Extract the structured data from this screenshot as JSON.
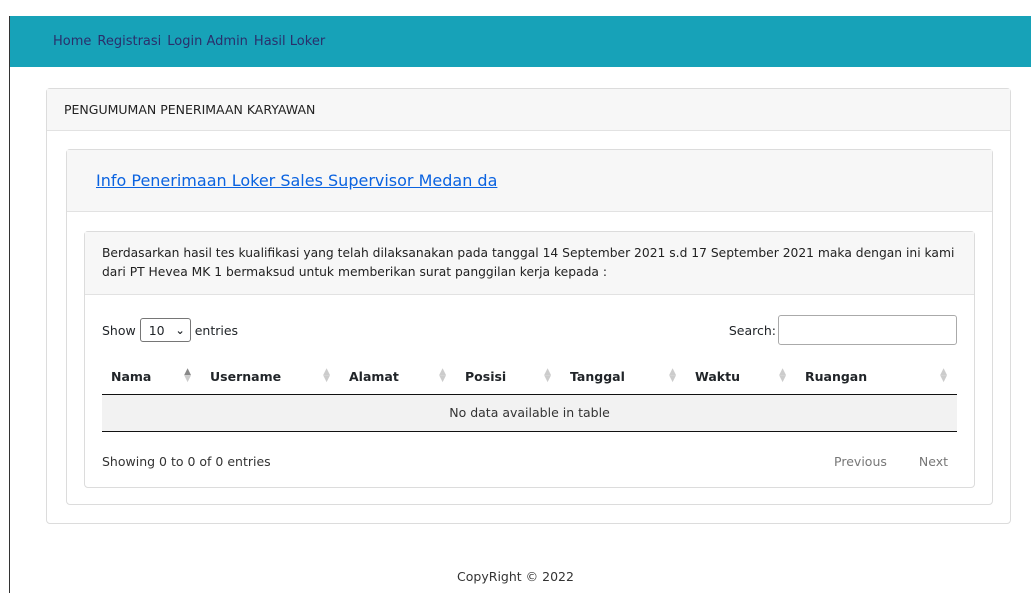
{
  "nav": {
    "items": [
      {
        "label": "Home"
      },
      {
        "label": "Registrasi"
      },
      {
        "label": "Login Admin"
      },
      {
        "label": "Hasil Loker"
      }
    ]
  },
  "panel": {
    "title": "PENGUMUMAN PENERIMAAN KARYAWAN"
  },
  "announcement": {
    "link_text": "Info Penerimaan Loker Sales Supervisor Medan da",
    "body": "Berdasarkan hasil tes kualifikasi yang telah dilaksanakan pada tanggal 14 September 2021 s.d 17 September 2021 maka dengan ini kami dari PT Hevea MK 1 bermaksud untuk memberikan surat panggilan kerja kepada :"
  },
  "table": {
    "show_label": "Show",
    "entries_label": "entries",
    "page_length": "10",
    "search_label": "Search:",
    "search_value": "",
    "columns": [
      "Nama",
      "Username",
      "Alamat",
      "Posisi",
      "Tanggal",
      "Waktu",
      "Ruangan"
    ],
    "empty_message": "No data available in table",
    "info": "Showing 0 to 0 of 0 entries",
    "previous_label": "Previous",
    "next_label": "Next"
  },
  "footer": {
    "text": "CopyRight © 2022"
  },
  "colors": {
    "navbar_bg": "#17a2b8",
    "nav_link": "#2a2f6b",
    "link": "#0b63e0"
  }
}
